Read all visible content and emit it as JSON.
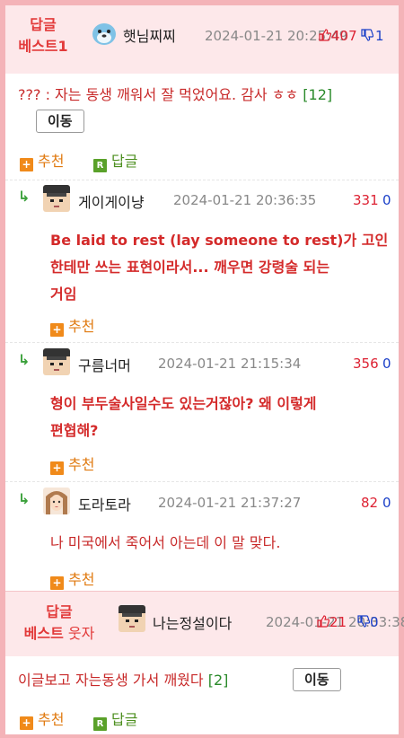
{
  "best1": {
    "label_line1": "답글",
    "label_line2": "베스트1",
    "nick": "햇님찌찌",
    "date": "2024-01-21 20:25:49",
    "up": "407",
    "down": "1",
    "text": "??? : 자는 동생 깨워서 잘 먹었어요. 감사 ㅎㅎ",
    "count": "[12]",
    "move": "이동",
    "recommend": "추천",
    "reply": "답글"
  },
  "replies": [
    {
      "nick": "게이게이냥",
      "date": "2024-01-21 20:36:35",
      "up": "331",
      "down": "0",
      "text_lines": [
        "Be laid to rest (lay someone to rest)가 고인",
        "한테만 쓰는 표현이라서... 깨우면 강령술 되는",
        "거임"
      ],
      "recommend": "추천"
    },
    {
      "nick": "구름너머",
      "date": "2024-01-21 21:15:34",
      "up": "356",
      "down": "0",
      "text_lines": [
        "형이 부두술사일수도 있는거잖아? 왜 이렇게",
        "편협해?"
      ],
      "recommend": "추천"
    },
    {
      "nick": "도라토라",
      "date": "2024-01-21 21:37:27",
      "up": "82",
      "down": "0",
      "text": "나 미국에서 죽어서 아는데 이 말 맞다.",
      "recommend": "추천"
    }
  ],
  "best2": {
    "label_line1": "답글",
    "label_line2a": "베스트",
    "label_line2b": " 웃자",
    "nick": "나는정설이다",
    "date": "2024-01-21 20:33:38",
    "up": "21",
    "down": "0",
    "text": "이글보고 자는동생 가서 깨웠다",
    "count": "[2]",
    "move": "이동",
    "recommend": "추천",
    "reply": "답글"
  },
  "icons": {
    "thumb_up": "thumb-up-icon",
    "thumb_down": "thumb-down-icon",
    "reply_arrow": "↳",
    "plus": "+",
    "r": "R"
  },
  "colors": {
    "border": "#f4b3b8",
    "header_bg": "#fde8ea",
    "red": "#e23a3a",
    "blue": "#1a3fc8",
    "orange": "#e07a10",
    "green": "#5aa12a"
  }
}
